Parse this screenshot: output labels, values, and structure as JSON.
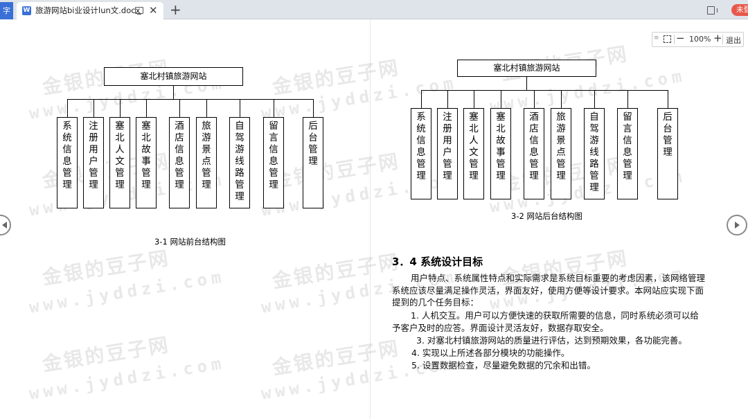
{
  "tabbar": {
    "left_tab_label": "字",
    "doc_tab_icon_letter": "W",
    "doc_tab_title": "旅游网站bi业设计lun文.docx",
    "close_glyph": "✕",
    "new_tab_glyph": "+",
    "login_label": "未登"
  },
  "watermark": {
    "line1": "金银的豆子网",
    "line2": "www.jyddzi.com"
  },
  "left_page": {
    "root_label": "塞北村镇旅游网站",
    "nodes": [
      "系统信息管理",
      "注册用户管理",
      "塞北人文管理",
      "塞北故事管理",
      "酒店信息管理",
      "旅游景点管理",
      "自驾游线路管理",
      "留言信息管理",
      "后台管理"
    ],
    "caption": "3-1 网站前台结构图"
  },
  "right_page": {
    "root_label": "塞北村镇旅游网站",
    "nodes": [
      "系统信息管理",
      "注册用户管理",
      "塞北人文管理",
      "塞北故事管理",
      "酒店信息管理",
      "旅游景点管理",
      "自驾游线路管理",
      "留言信息管理",
      "后台管理"
    ],
    "caption": "3-2 网站后台结构图",
    "section_heading": "3．4 系统设计目标",
    "paragraphs": [
      "用户特点、系统属性特点和实际需求是系统目标重要的考虑因素，该网络管理系统应该尽量满足操作灵活，界面友好，使用方便等设计要求。本网站应实现下面提到的几个任务目标：",
      "1. 人机交互。用户可以方便快速的获取所需要的信息，同时系统必须可以给予客户及时的应答。界面设计灵活友好，数据存取安全。",
      "3. 对塞北村镇旅游网站的质量进行评估，达到预期效果，各功能完善。",
      "4. 实现以上所述各部分模块的功能操作。",
      "5. 设置数据检查，尽量避免数据的冗余和出错。"
    ]
  },
  "zoom": {
    "grip_glyph": "≡",
    "minus": "−",
    "value": "100%",
    "plus": "+",
    "exit_label": "退出"
  }
}
